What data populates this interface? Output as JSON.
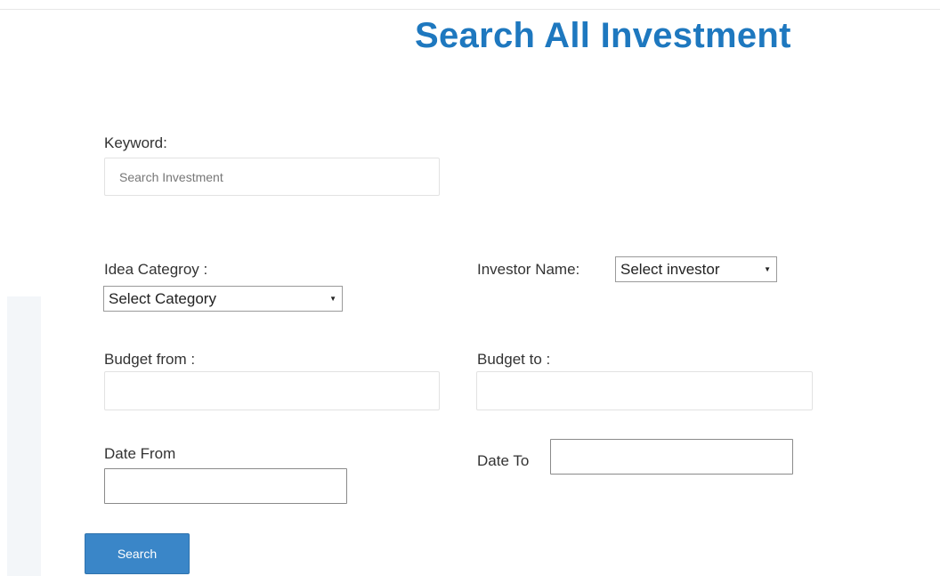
{
  "title": "Search All Investment",
  "keyword": {
    "label": "Keyword:",
    "placeholder": "Search Investment",
    "value": ""
  },
  "category": {
    "label": "Idea Categroy :",
    "selected": "Select Category"
  },
  "investor": {
    "label": "Investor Name:",
    "selected": "Select investor"
  },
  "budget_from": {
    "label": "Budget from :",
    "value": ""
  },
  "budget_to": {
    "label": "Budget to :",
    "value": ""
  },
  "date_from": {
    "label": "Date From",
    "value": ""
  },
  "date_to": {
    "label": "Date To",
    "value": ""
  },
  "search_button": {
    "label": "Search"
  },
  "icons": {
    "dropdown_arrow": "▼"
  },
  "colors": {
    "title": "#1e78bf",
    "button": "#3a86c8",
    "text": "#333333"
  }
}
